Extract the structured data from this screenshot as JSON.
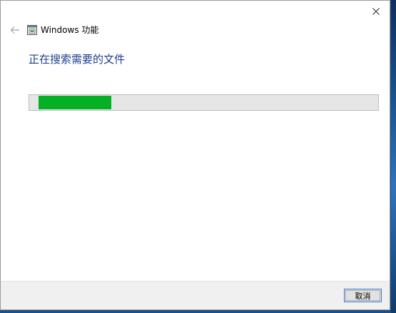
{
  "window": {
    "title": "Windows 功能",
    "heading": "正在搜索需要的文件"
  },
  "progress": {
    "value_fraction": 0.22,
    "color": "#06b025"
  },
  "buttons": {
    "cancel_label": "取消"
  },
  "icons": {
    "back": "back-arrow-icon",
    "app": "windows-features-icon",
    "close": "close-icon"
  }
}
